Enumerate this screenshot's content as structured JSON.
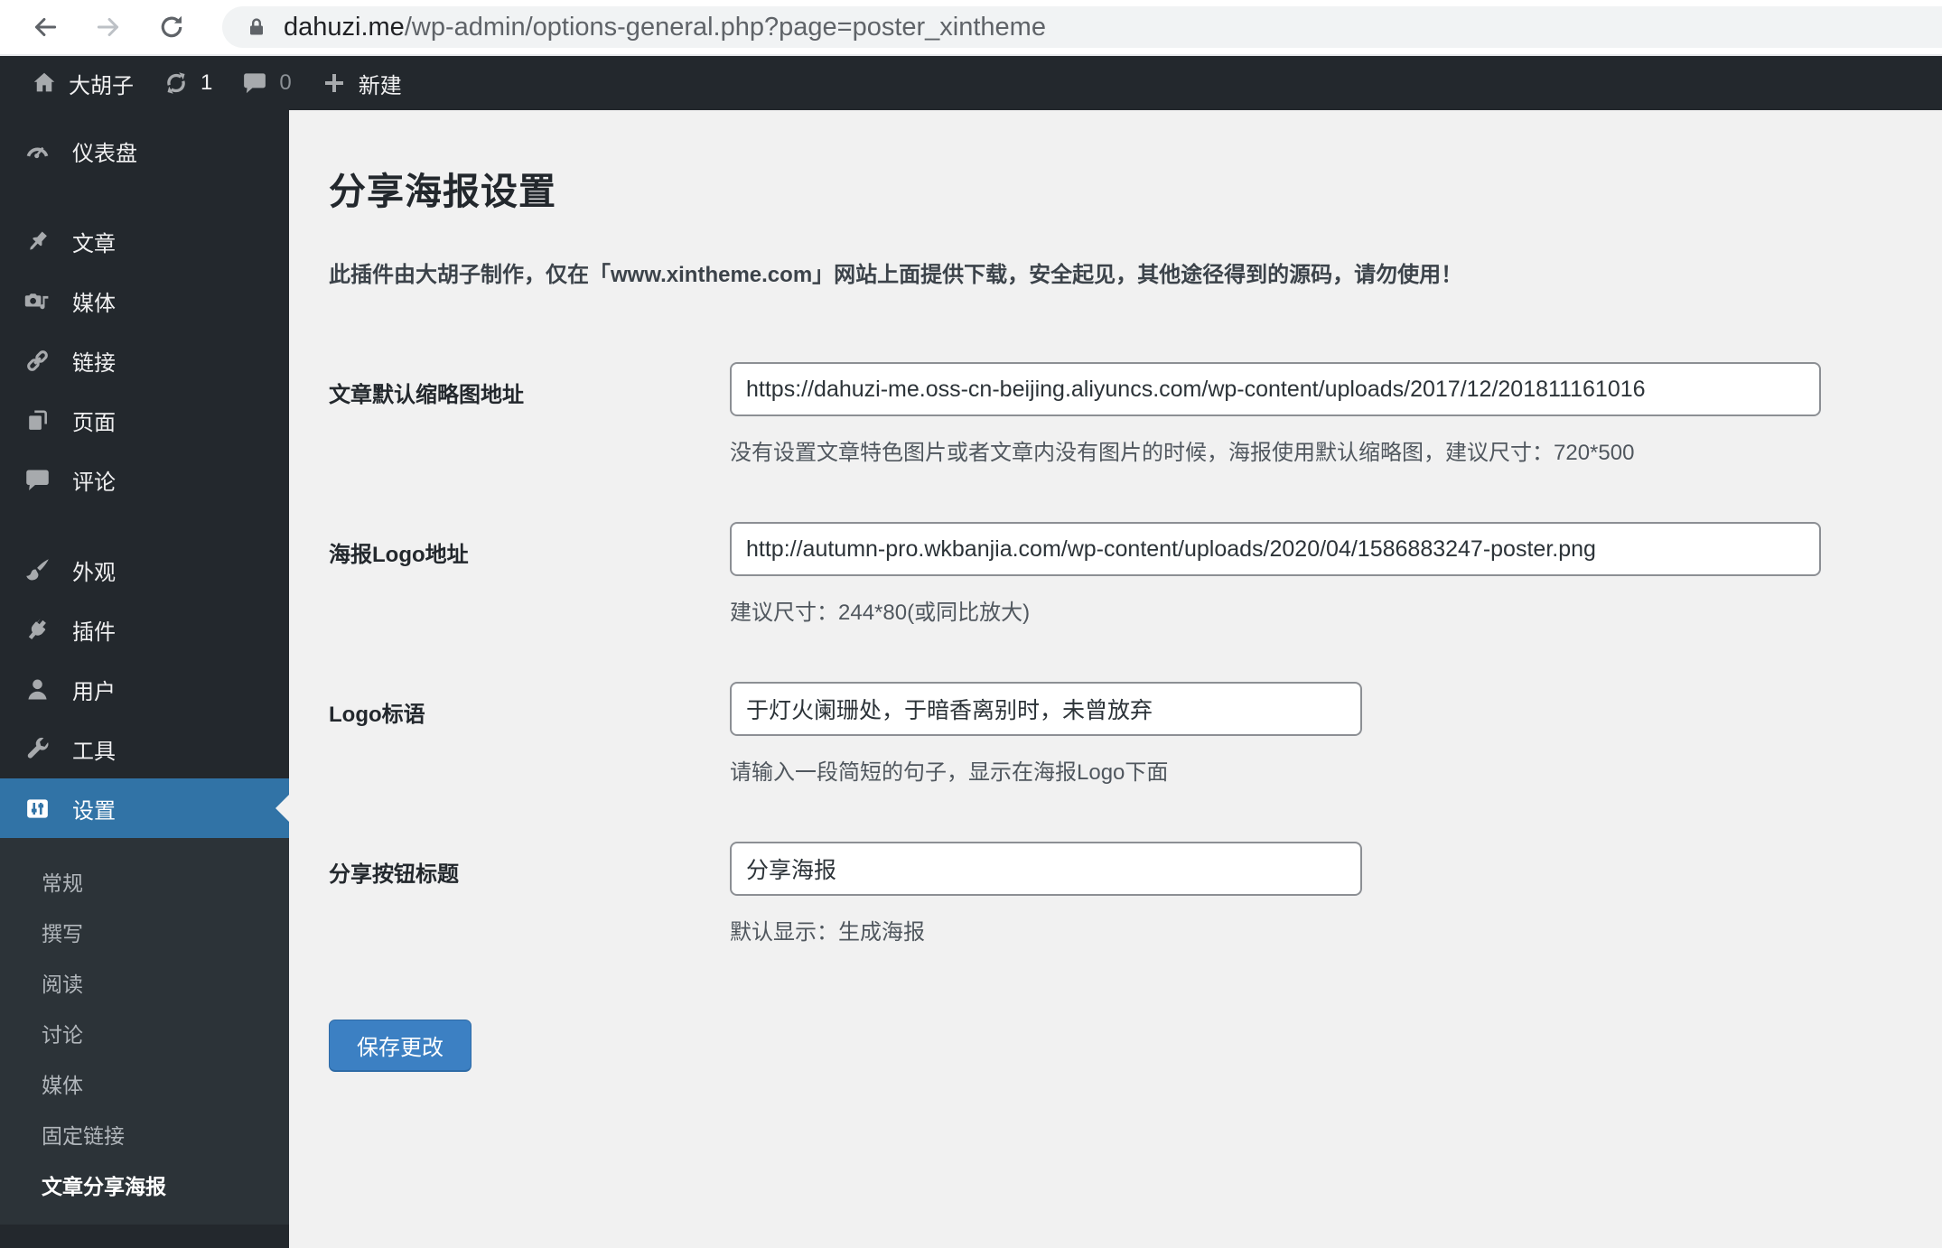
{
  "browser": {
    "url_host": "dahuzi.me",
    "url_path": "/wp-admin/options-general.php?page=poster_xintheme"
  },
  "admin_bar": {
    "site_name": "大胡子",
    "update_count": "1",
    "comment_count": "0",
    "new_label": "新建"
  },
  "sidebar": {
    "items": [
      {
        "label": "仪表盘",
        "icon": "dashboard-gauge-icon"
      },
      {
        "label": "文章",
        "icon": "pushpin-icon"
      },
      {
        "label": "媒体",
        "icon": "media-camera-icon"
      },
      {
        "label": "链接",
        "icon": "link-chain-icon"
      },
      {
        "label": "页面",
        "icon": "pages-icon"
      },
      {
        "label": "评论",
        "icon": "comment-bubble-icon"
      },
      {
        "label": "外观",
        "icon": "brush-icon"
      },
      {
        "label": "插件",
        "icon": "plug-icon"
      },
      {
        "label": "用户",
        "icon": "user-icon"
      },
      {
        "label": "工具",
        "icon": "wrench-icon"
      },
      {
        "label": "设置",
        "icon": "sliders-icon"
      }
    ],
    "settings_submenu": [
      "常规",
      "撰写",
      "阅读",
      "讨论",
      "媒体",
      "固定链接",
      "文章分享海报"
    ]
  },
  "main": {
    "title": "分享海报设置",
    "notice": "此插件由大胡子制作，仅在「www.xintheme.com」网站上面提供下载，安全起见，其他途径得到的源码，请勿使用！",
    "fields": [
      {
        "label": "文章默认缩略图地址",
        "value": "https://dahuzi-me.oss-cn-beijing.aliyuncs.com/wp-content/uploads/2017/12/201811161016",
        "help": "没有设置文章特色图片或者文章内没有图片的时候，海报使用默认缩略图，建议尺寸：720*500"
      },
      {
        "label": "海报Logo地址",
        "value": "http://autumn-pro.wkbanjia.com/wp-content/uploads/2020/04/1586883247-poster.png",
        "help": "建议尺寸：244*80(或同比放大)"
      },
      {
        "label": "Logo标语",
        "value": "于灯火阑珊处，于暗香离别时，未曾放弃",
        "help": "请输入一段简短的句子，显示在海报Logo下面"
      },
      {
        "label": "分享按钮标题",
        "value": "分享海报",
        "help": "默认显示：生成海报"
      }
    ],
    "save_label": "保存更改"
  },
  "colors": {
    "accent": "#3173a6",
    "button": "#3c80c3",
    "admin_dark": "#23282d",
    "submenu_bg": "#2c3338",
    "content_bg": "#f1f1f1"
  }
}
